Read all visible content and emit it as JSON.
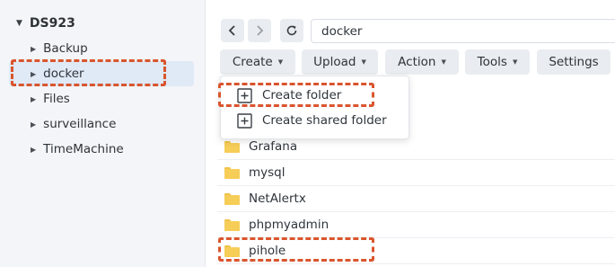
{
  "sidebar": {
    "root_label": "DS923",
    "items": [
      {
        "label": "Backup"
      },
      {
        "label": "docker"
      },
      {
        "label": "Files"
      },
      {
        "label": "surveillance"
      },
      {
        "label": "TimeMachine"
      }
    ]
  },
  "toolbar": {
    "path_value": "docker",
    "buttons": [
      {
        "label": "Create"
      },
      {
        "label": "Upload"
      },
      {
        "label": "Action"
      },
      {
        "label": "Tools"
      },
      {
        "label": "Settings"
      }
    ]
  },
  "create_menu": {
    "items": [
      {
        "label": "Create folder",
        "icon": "add-box-icon"
      },
      {
        "label": "Create shared folder",
        "icon": "add-box-icon"
      }
    ]
  },
  "file_list": {
    "rows": [
      {
        "name": "Grafana"
      },
      {
        "name": "mysql"
      },
      {
        "name": "NetAlertx"
      },
      {
        "name": "phpmyadmin"
      },
      {
        "name": "pihole"
      }
    ]
  },
  "colors": {
    "highlight": "#d9552e",
    "folder": "#f6cd57",
    "selected": "#e0e9f6",
    "sidebar": "#f3f5f8"
  }
}
